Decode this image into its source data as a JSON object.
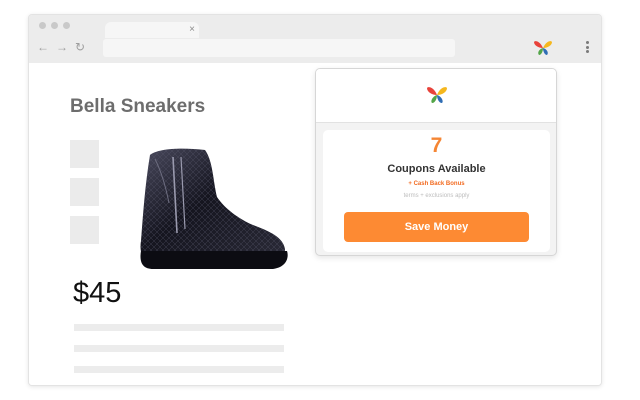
{
  "browser": {
    "tab_close_glyph": "×",
    "back_glyph": "←",
    "forward_glyph": "→",
    "reload_glyph": "↻",
    "extension_icon": "butterfly-logo-icon",
    "menu_icon": "kebab-menu-icon"
  },
  "product": {
    "title": "Bella Sneakers",
    "price": "$45",
    "image_icon": "black-patent-ankle-boot"
  },
  "popup": {
    "logo_icon": "butterfly-logo-icon",
    "coupon_count": "7",
    "coupons_label": "Coupons Available",
    "cashback_label": "+ Cash Back Bonus",
    "terms_label": "terms + exclusions apply",
    "button_label": "Save Money"
  },
  "colors": {
    "accent_orange": "#fd8a33",
    "count_orange": "#f58634",
    "cashback_orange": "#f26b21",
    "logo_red": "#e8423a",
    "logo_yellow": "#f5b71d",
    "logo_green": "#53a548",
    "logo_blue": "#2f6db4"
  }
}
